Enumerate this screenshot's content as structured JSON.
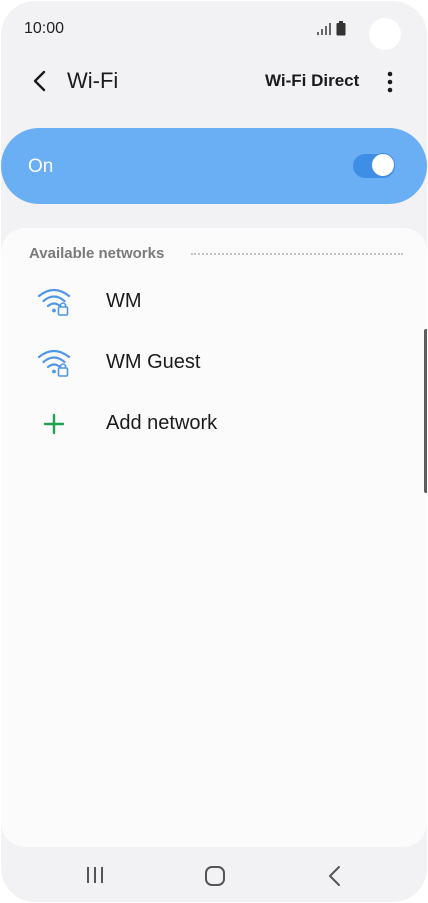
{
  "status_bar": {
    "time": "10:00",
    "signal_icon": "signal-icon",
    "battery_icon": "battery-icon"
  },
  "header": {
    "back_icon": "chevron-left-icon",
    "title": "Wi-Fi",
    "wifi_direct_label": "Wi-Fi Direct",
    "more_icon": "more-vertical-icon"
  },
  "master_switch": {
    "label": "On",
    "state": true
  },
  "networks_section": {
    "header": "Available networks",
    "items": [
      {
        "name": "WM",
        "icon": "wifi-secured-icon"
      },
      {
        "name": "WM Guest",
        "icon": "wifi-secured-icon"
      }
    ],
    "add_network": {
      "label": "Add network",
      "icon": "plus-icon"
    }
  },
  "nav_bar": {
    "recents_icon": "recents-icon",
    "home_icon": "home-icon",
    "back_icon": "back-icon"
  },
  "colors": {
    "accent": "#3e8ee6",
    "master_bar": "#6aaef4",
    "wifi_icon": "#4f97e6",
    "add_icon": "#1fa551",
    "background": "#f2f2f4",
    "card": "#fbfbfb"
  }
}
